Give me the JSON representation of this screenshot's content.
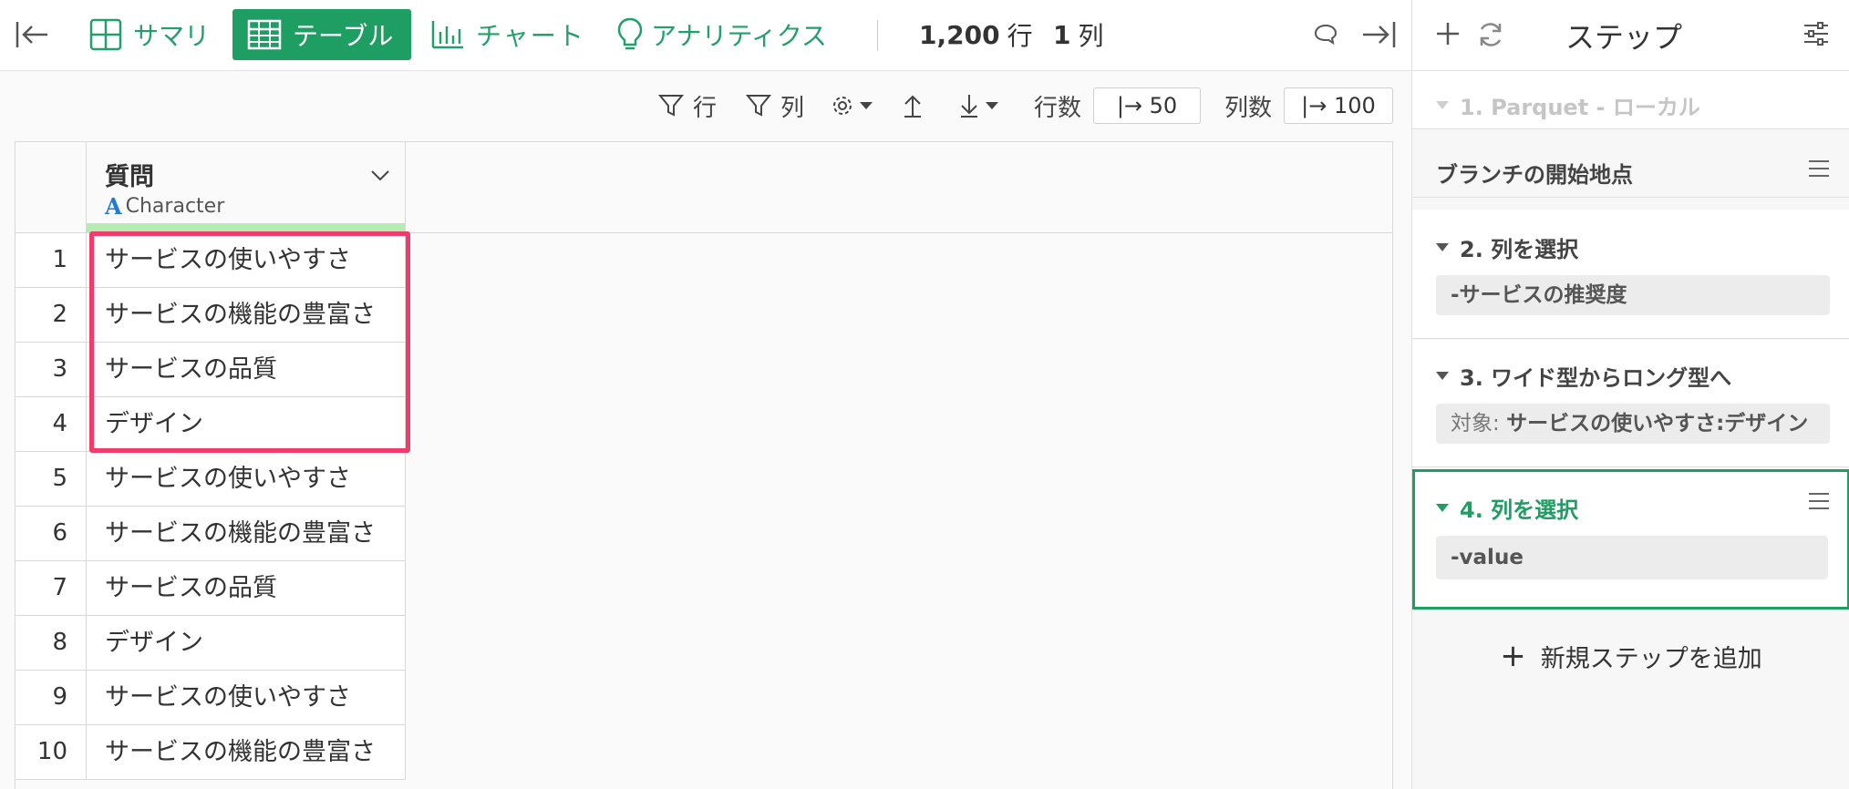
{
  "toolbar": {
    "tabs": [
      {
        "label": "サマリ",
        "icon": "summary-grid-icon"
      },
      {
        "label": "テーブル",
        "icon": "table-icon",
        "active": true
      },
      {
        "label": "チャート",
        "icon": "bar-chart-icon"
      },
      {
        "label": "アナリティクス",
        "icon": "lightbulb-icon"
      }
    ],
    "rows_count": "1,200",
    "rows_unit": "行",
    "cols_count": "1",
    "cols_unit": "列"
  },
  "subbar": {
    "filter_rows": "行",
    "filter_cols": "列",
    "row_count_label": "行数",
    "row_count_value": "|→ 50",
    "col_count_label": "列数",
    "col_count_value": "|→ 100"
  },
  "table": {
    "column": {
      "name": "質問",
      "type": "Character",
      "type_icon": "A"
    },
    "rows": [
      {
        "num": "1",
        "value": "サービスの使いやすさ"
      },
      {
        "num": "2",
        "value": "サービスの機能の豊富さ"
      },
      {
        "num": "3",
        "value": "サービスの品質"
      },
      {
        "num": "4",
        "value": "デザイン"
      },
      {
        "num": "5",
        "value": "サービスの使いやすさ"
      },
      {
        "num": "6",
        "value": "サービスの機能の豊富さ"
      },
      {
        "num": "7",
        "value": "サービスの品質"
      },
      {
        "num": "8",
        "value": "デザイン"
      },
      {
        "num": "9",
        "value": "サービスの使いやすさ"
      },
      {
        "num": "10",
        "value": "サービスの機能の豊富さ"
      }
    ]
  },
  "panel": {
    "title": "ステップ",
    "steps": [
      {
        "title": "1. Parquet - ローカル"
      },
      {
        "title": "ブランチの開始地点"
      },
      {
        "title": "2. 列を選択",
        "chip": "-サービスの推奨度"
      },
      {
        "title": "3. ワイド型からロング型へ",
        "chip_prefix": "対象: ",
        "chip": "サービスの使いやすさ:デザイン"
      },
      {
        "title": "4. 列を選択",
        "chip": "-value"
      }
    ],
    "add_step": "新規ステップを追加"
  },
  "colors": {
    "accent": "#1f9e63",
    "highlight": "#ee3d6d",
    "type_icon": "#1e7bd6"
  }
}
